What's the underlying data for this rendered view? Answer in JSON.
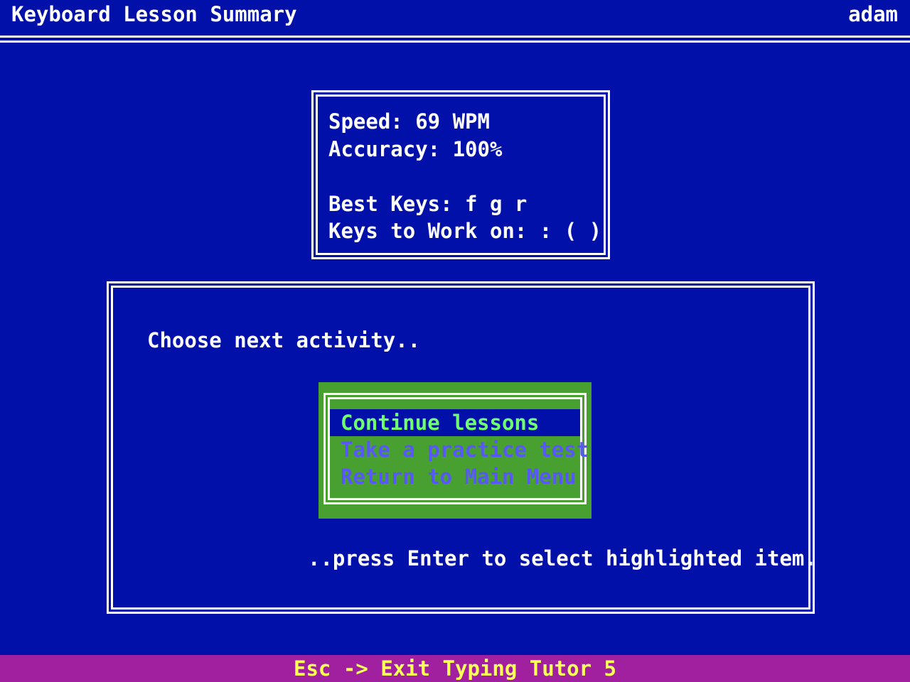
{
  "header": {
    "title": "Keyboard Lesson Summary",
    "user": "adam"
  },
  "stats": {
    "speed": "Speed: 69 WPM",
    "accuracy": "Accuracy: 100%",
    "best_keys": "Best Keys: f g r",
    "keys_to_work_on": "Keys to Work on: : ( )"
  },
  "activity": {
    "prompt": "Choose next activity..",
    "menu": [
      {
        "label": "Continue lessons",
        "selected": true
      },
      {
        "label": "Take a practice test",
        "selected": false
      },
      {
        "label": "Return to Main Menu",
        "selected": false
      }
    ],
    "hint": "..press Enter to select highlighted item."
  },
  "footer": {
    "text": "Esc -> Exit Typing Tutor 5"
  },
  "colors": {
    "background": "#0010a8",
    "menu_background": "#48a030",
    "menu_selected_text": "#70ff70",
    "menu_item_text": "#5858f8",
    "footer_background": "#a020a0",
    "footer_text": "#ffff58"
  }
}
